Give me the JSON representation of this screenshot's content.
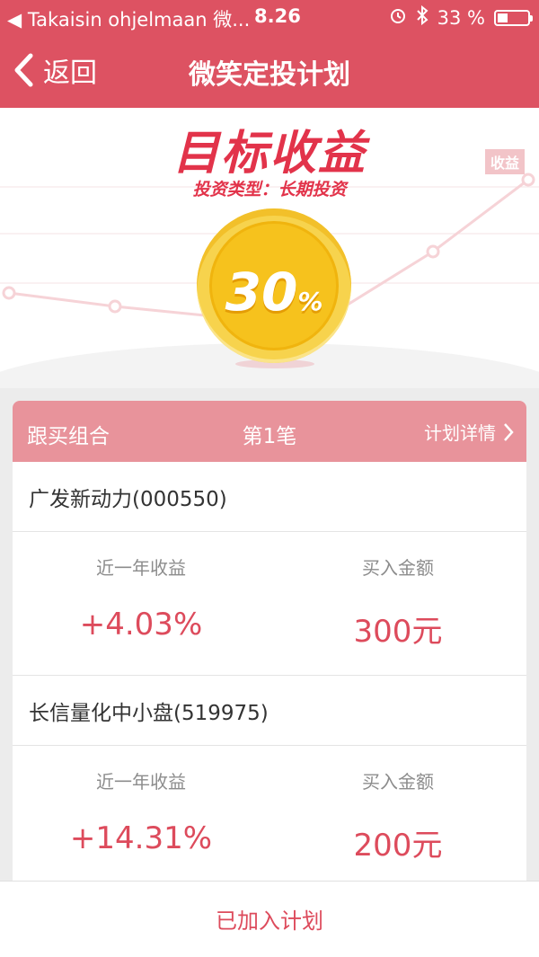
{
  "status_bar": {
    "back_text": "◀ Takaisin ohjelmaan 微...",
    "time": "8.26",
    "battery": "33 %",
    "battery_level": 0.33
  },
  "nav": {
    "back_label": "返回",
    "title": "微笑定投计划"
  },
  "hero": {
    "title": "目标收益",
    "subtitle": "投资类型：长期投资",
    "tag": "收益",
    "rate_number": "30",
    "rate_unit": "%"
  },
  "plan_card": {
    "left_label": "跟买组合",
    "center_label": "第1笔",
    "details_link": "计划详情",
    "funds": [
      {
        "name": "广发新动力(000550)",
        "return_label": "近一年收益",
        "return_value": "+4.03%",
        "amount_label": "买入金额",
        "amount_value": "300元"
      },
      {
        "name": "长信量化中小盘(519975)",
        "return_label": "近一年收益",
        "return_value": "+14.31%",
        "amount_label": "买入金额",
        "amount_value": "200元"
      }
    ]
  },
  "bottom": {
    "button_label": "已加入计划"
  },
  "colors": {
    "primary": "#dd5262",
    "card_header": "#e8939b",
    "accent_text": "#dd4b5c",
    "coin": "#f6c21d"
  }
}
